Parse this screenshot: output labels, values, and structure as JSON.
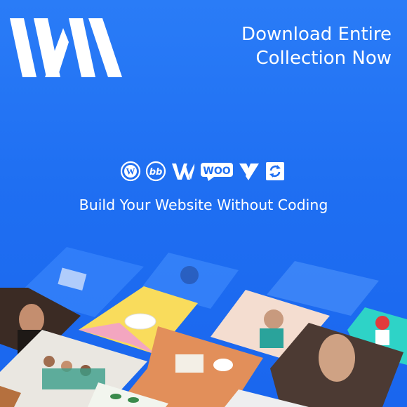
{
  "banner": {
    "brand_logo": "wm-logo",
    "headline_line1": "Download Entire",
    "headline_line2": "Collection Now",
    "tagline": "Build Your Website Without Coding",
    "platform_icons": [
      "wordpress-icon",
      "beaver-builder-icon",
      "wpbakery-icon",
      "woocommerce-icon",
      "visual-composer-icon",
      "updates-icon"
    ],
    "woo_label": "WOO",
    "colors": {
      "background": "#1f6ff2",
      "text": "#ffffff"
    }
  }
}
